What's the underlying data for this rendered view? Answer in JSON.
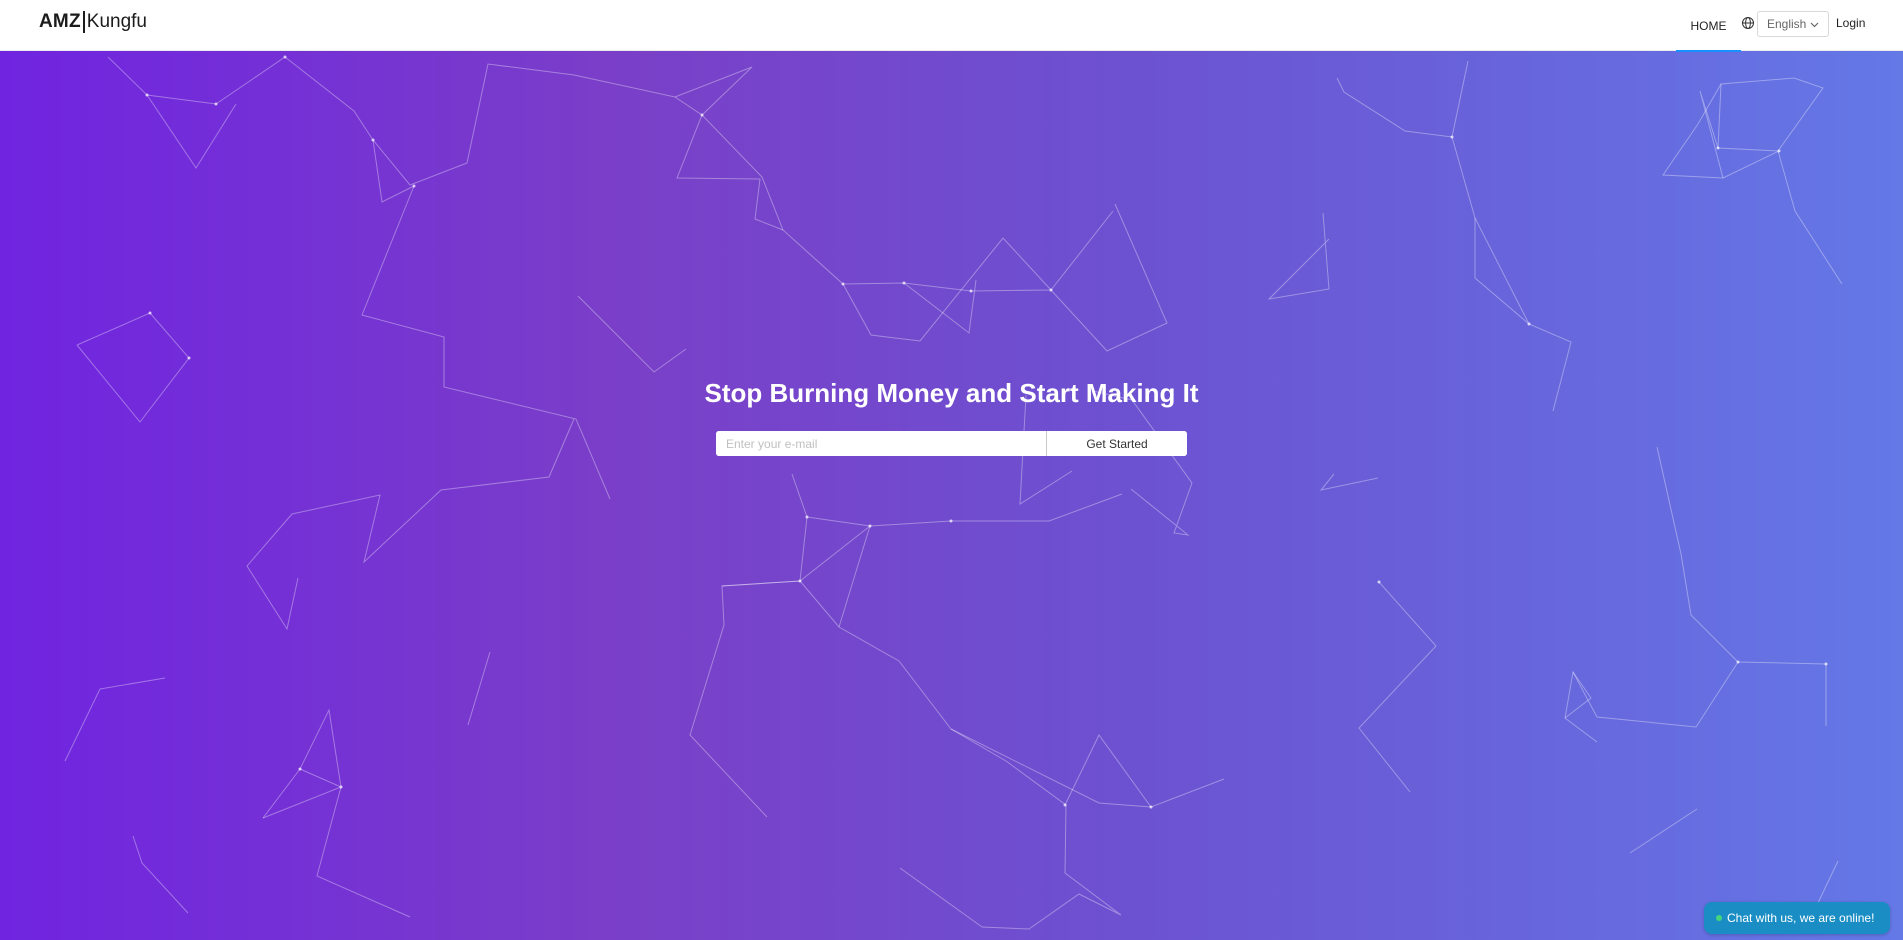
{
  "header": {
    "logo": {
      "bold": "AMZ",
      "light": "Kungfu"
    },
    "nav_home": "HOME",
    "language": {
      "icon": "globe-icon",
      "selected": "English",
      "chevron": "chevron-down-icon"
    },
    "login": "Login",
    "active_underline_color": "#1890ff"
  },
  "hero": {
    "title": "Stop Burning Money and Start Making It",
    "email_placeholder": "Enter your e-mail",
    "cta_label": "Get Started",
    "gradient_colors": [
      "#7024e0",
      "#7a3fc8",
      "#6c52d1",
      "#6478e6"
    ]
  },
  "chat": {
    "label": "Chat with us, we are online!",
    "status_color": "#43d67a",
    "background": "#1a8ec4"
  }
}
